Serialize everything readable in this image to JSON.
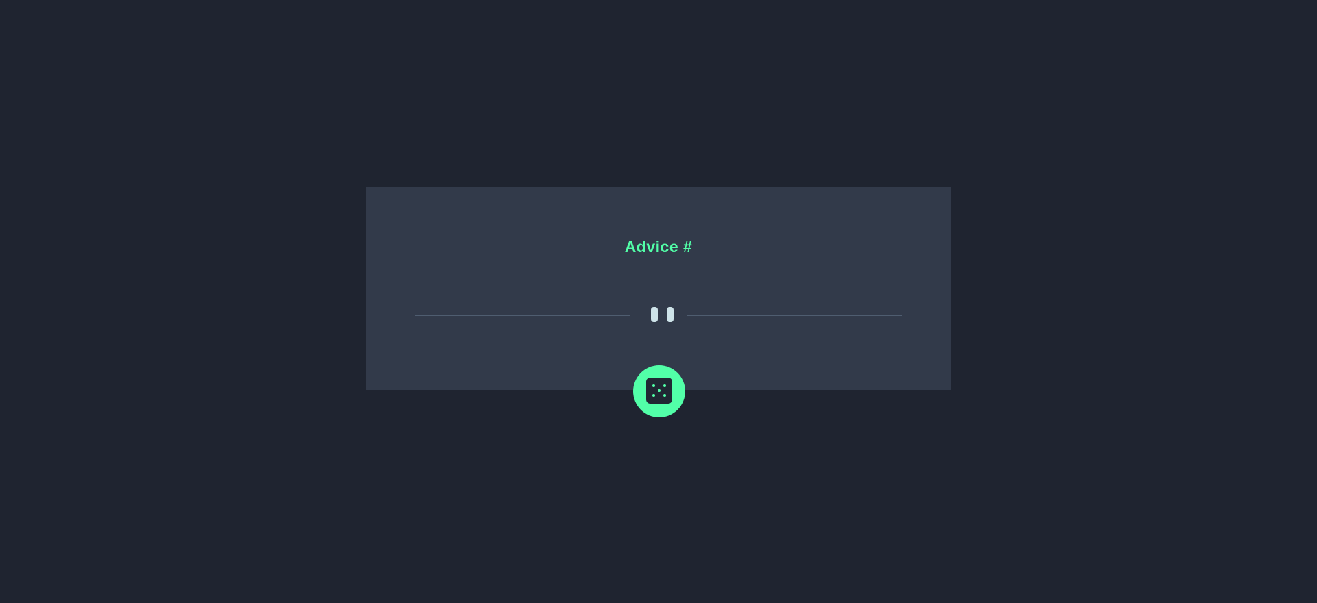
{
  "card": {
    "title": "Advice #",
    "advice_text": ""
  },
  "icons": {
    "divider": "pause-icon",
    "generate": "dice-icon"
  },
  "colors": {
    "background": "#1f2430",
    "card": "#323a4a",
    "accent": "#52ffa8",
    "text": "#cee3e9",
    "divider": "#4f5d70"
  }
}
